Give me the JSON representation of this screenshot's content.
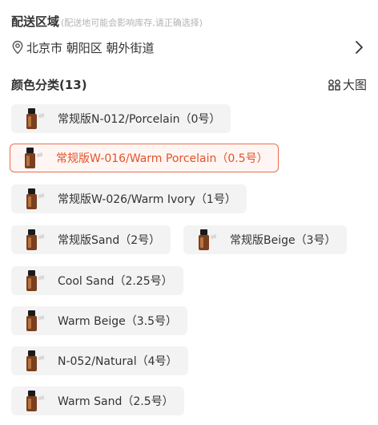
{
  "delivery": {
    "title": "配送区域",
    "hint": "(配送地可能会影响库存,请正确选择)",
    "address": "北京市 朝阳区 朝外街道"
  },
  "colors": {
    "title": "颜色分类(13)",
    "big_view_label": "大图",
    "options": [
      {
        "label": "常规版N-012/Porcelain（0号）",
        "selected": false
      },
      {
        "label": "常规版W-016/Warm Porcelain（0.5号）",
        "selected": true
      },
      {
        "label": "常规版W-026/Warm Ivory（1号）",
        "selected": false
      },
      {
        "label": "常规版Sand（2号）",
        "selected": false
      },
      {
        "label": "常规版Beige（3号）",
        "selected": false
      },
      {
        "label": "Cool Sand（2.25号）",
        "selected": false
      },
      {
        "label": "Warm Beige（3.5号）",
        "selected": false
      },
      {
        "label": "N-052/Natural（4号）",
        "selected": false
      },
      {
        "label": "Warm Sand（2.5号）",
        "selected": false
      }
    ]
  },
  "accent_color": "#e8704f"
}
